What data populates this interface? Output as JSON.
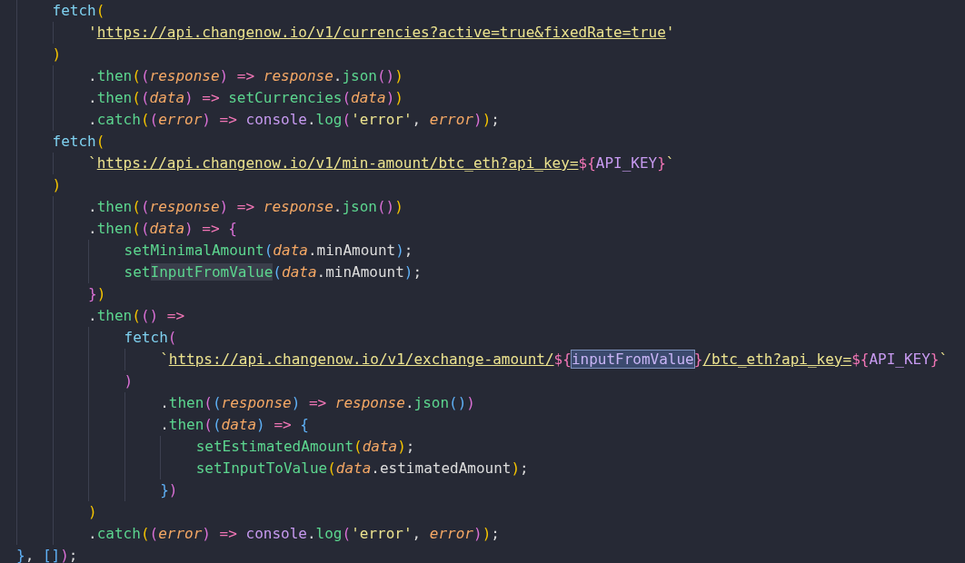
{
  "lines": [
    {
      "tokens": [
        {
          "kind": "call",
          "text": "    fetch"
        },
        {
          "kind": "b1",
          "text": "("
        }
      ]
    },
    {
      "tokens": [
        {
          "kind": "str",
          "text": "        '"
        },
        {
          "kind": "link",
          "text": "https://api.changenow.io/v1/currencies?active=true&fixedRate=true"
        },
        {
          "kind": "str",
          "text": "'"
        }
      ]
    },
    {
      "tokens": [
        {
          "kind": "b1",
          "text": "    )"
        }
      ]
    },
    {
      "tokens": [
        {
          "kind": "plain",
          "text": "        ."
        },
        {
          "kind": "fn",
          "text": "then"
        },
        {
          "kind": "b1",
          "text": "("
        },
        {
          "kind": "b2",
          "text": "("
        },
        {
          "kind": "param",
          "text": "response"
        },
        {
          "kind": "b2",
          "text": ")"
        },
        {
          "kind": "op",
          "text": " => "
        },
        {
          "kind": "param",
          "text": "response"
        },
        {
          "kind": "plain",
          "text": "."
        },
        {
          "kind": "fn",
          "text": "json"
        },
        {
          "kind": "b2",
          "text": "()"
        },
        {
          "kind": "b1",
          "text": ")"
        }
      ]
    },
    {
      "tokens": [
        {
          "kind": "plain",
          "text": "        ."
        },
        {
          "kind": "fn",
          "text": "then"
        },
        {
          "kind": "b1",
          "text": "("
        },
        {
          "kind": "b2",
          "text": "("
        },
        {
          "kind": "param",
          "text": "data"
        },
        {
          "kind": "b2",
          "text": ")"
        },
        {
          "kind": "op",
          "text": " => "
        },
        {
          "kind": "fn",
          "text": "setCurrencies"
        },
        {
          "kind": "b2",
          "text": "("
        },
        {
          "kind": "param",
          "text": "data"
        },
        {
          "kind": "b2",
          "text": ")"
        },
        {
          "kind": "b1",
          "text": ")"
        }
      ]
    },
    {
      "tokens": [
        {
          "kind": "plain",
          "text": "        ."
        },
        {
          "kind": "fn",
          "text": "catch"
        },
        {
          "kind": "b1",
          "text": "("
        },
        {
          "kind": "b2",
          "text": "("
        },
        {
          "kind": "param",
          "text": "error"
        },
        {
          "kind": "b2",
          "text": ")"
        },
        {
          "kind": "op",
          "text": " => "
        },
        {
          "kind": "obj",
          "text": "console"
        },
        {
          "kind": "plain",
          "text": "."
        },
        {
          "kind": "fn",
          "text": "log"
        },
        {
          "kind": "b2",
          "text": "("
        },
        {
          "kind": "str",
          "text": "'error'"
        },
        {
          "kind": "plain",
          "text": ", "
        },
        {
          "kind": "param",
          "text": "error"
        },
        {
          "kind": "b2",
          "text": ")"
        },
        {
          "kind": "b1",
          "text": ")"
        },
        {
          "kind": "plain",
          "text": ";"
        }
      ]
    },
    {
      "tokens": [
        {
          "kind": "call",
          "text": "    fetch"
        },
        {
          "kind": "b1",
          "text": "("
        }
      ]
    },
    {
      "tokens": [
        {
          "kind": "str",
          "text": "        `"
        },
        {
          "kind": "link",
          "text": "https://api.changenow.io/v1/min-amount/btc_eth?api_key="
        },
        {
          "kind": "op",
          "text": "${"
        },
        {
          "kind": "var",
          "text": "API_KEY"
        },
        {
          "kind": "op",
          "text": "}"
        },
        {
          "kind": "str",
          "text": "`"
        }
      ]
    },
    {
      "tokens": [
        {
          "kind": "b1",
          "text": "    )"
        }
      ]
    },
    {
      "tokens": [
        {
          "kind": "plain",
          "text": "        ."
        },
        {
          "kind": "fn",
          "text": "then"
        },
        {
          "kind": "b1",
          "text": "("
        },
        {
          "kind": "b2",
          "text": "("
        },
        {
          "kind": "param",
          "text": "response"
        },
        {
          "kind": "b2",
          "text": ")"
        },
        {
          "kind": "op",
          "text": " => "
        },
        {
          "kind": "param",
          "text": "response"
        },
        {
          "kind": "plain",
          "text": "."
        },
        {
          "kind": "fn",
          "text": "json"
        },
        {
          "kind": "b2",
          "text": "()"
        },
        {
          "kind": "b1",
          "text": ")"
        }
      ]
    },
    {
      "tokens": [
        {
          "kind": "plain",
          "text": "        ."
        },
        {
          "kind": "fn",
          "text": "then"
        },
        {
          "kind": "b1",
          "text": "("
        },
        {
          "kind": "b2",
          "text": "("
        },
        {
          "kind": "param",
          "text": "data"
        },
        {
          "kind": "b2",
          "text": ")"
        },
        {
          "kind": "op",
          "text": " => "
        },
        {
          "kind": "b2",
          "text": "{"
        }
      ]
    },
    {
      "tokens": [
        {
          "kind": "fn",
          "text": "            setMinimalAmount"
        },
        {
          "kind": "b3",
          "text": "("
        },
        {
          "kind": "param",
          "text": "data"
        },
        {
          "kind": "plain",
          "text": ".minAmount"
        },
        {
          "kind": "b3",
          "text": ")"
        },
        {
          "kind": "plain",
          "text": ";"
        }
      ]
    },
    {
      "tokens": [
        {
          "kind": "fn",
          "text": "            set"
        },
        {
          "kind": "fnmatch",
          "text": "InputFromValue"
        },
        {
          "kind": "b3",
          "text": "("
        },
        {
          "kind": "param",
          "text": "data"
        },
        {
          "kind": "plain",
          "text": ".minAmount"
        },
        {
          "kind": "b3",
          "text": ")"
        },
        {
          "kind": "plain",
          "text": ";"
        }
      ]
    },
    {
      "tokens": [
        {
          "kind": "b2",
          "text": "        }"
        },
        {
          "kind": "b1",
          "text": ")"
        }
      ]
    },
    {
      "tokens": [
        {
          "kind": "plain",
          "text": "        ."
        },
        {
          "kind": "fn",
          "text": "then"
        },
        {
          "kind": "b1",
          "text": "("
        },
        {
          "kind": "b2",
          "text": "()"
        },
        {
          "kind": "op",
          "text": " =>"
        }
      ]
    },
    {
      "tokens": [
        {
          "kind": "call",
          "text": "            fetch"
        },
        {
          "kind": "b2",
          "text": "("
        }
      ]
    },
    {
      "tokens": [
        {
          "kind": "str",
          "text": "                `"
        },
        {
          "kind": "link",
          "text": "https://api.changenow.io/v1/exchange-amount/"
        },
        {
          "kind": "op",
          "text": "${"
        },
        {
          "kind": "sel",
          "text": "inputFromValue"
        },
        {
          "kind": "op",
          "text": "}"
        },
        {
          "kind": "link",
          "text": "/btc_eth?api_key="
        },
        {
          "kind": "op",
          "text": "${"
        },
        {
          "kind": "var",
          "text": "API_KEY"
        },
        {
          "kind": "op",
          "text": "}"
        },
        {
          "kind": "str",
          "text": "`"
        }
      ]
    },
    {
      "tokens": [
        {
          "kind": "b2",
          "text": "            )"
        }
      ]
    },
    {
      "tokens": [
        {
          "kind": "plain",
          "text": "                ."
        },
        {
          "kind": "fn",
          "text": "then"
        },
        {
          "kind": "b2",
          "text": "("
        },
        {
          "kind": "b3",
          "text": "("
        },
        {
          "kind": "param",
          "text": "response"
        },
        {
          "kind": "b3",
          "text": ")"
        },
        {
          "kind": "op",
          "text": " => "
        },
        {
          "kind": "param",
          "text": "response"
        },
        {
          "kind": "plain",
          "text": "."
        },
        {
          "kind": "fn",
          "text": "json"
        },
        {
          "kind": "b3",
          "text": "()"
        },
        {
          "kind": "b2",
          "text": ")"
        }
      ]
    },
    {
      "tokens": [
        {
          "kind": "plain",
          "text": "                ."
        },
        {
          "kind": "fn",
          "text": "then"
        },
        {
          "kind": "b2",
          "text": "("
        },
        {
          "kind": "b3",
          "text": "("
        },
        {
          "kind": "param",
          "text": "data"
        },
        {
          "kind": "b3",
          "text": ")"
        },
        {
          "kind": "op",
          "text": " => "
        },
        {
          "kind": "b3",
          "text": "{"
        }
      ]
    },
    {
      "tokens": [
        {
          "kind": "fn",
          "text": "                    setEstimatedAmount"
        },
        {
          "kind": "b1",
          "text": "("
        },
        {
          "kind": "param",
          "text": "data"
        },
        {
          "kind": "b1",
          "text": ")"
        },
        {
          "kind": "plain",
          "text": ";"
        }
      ]
    },
    {
      "tokens": [
        {
          "kind": "fn",
          "text": "                    setInputToValue"
        },
        {
          "kind": "b1",
          "text": "("
        },
        {
          "kind": "param",
          "text": "data"
        },
        {
          "kind": "plain",
          "text": ".estimatedAmount"
        },
        {
          "kind": "b1",
          "text": ")"
        },
        {
          "kind": "plain",
          "text": ";"
        }
      ]
    },
    {
      "tokens": [
        {
          "kind": "b3",
          "text": "                }"
        },
        {
          "kind": "b2",
          "text": ")"
        }
      ]
    },
    {
      "tokens": [
        {
          "kind": "b1",
          "text": "        )"
        }
      ]
    },
    {
      "tokens": [
        {
          "kind": "plain",
          "text": "        ."
        },
        {
          "kind": "fn",
          "text": "catch"
        },
        {
          "kind": "b1",
          "text": "("
        },
        {
          "kind": "b2",
          "text": "("
        },
        {
          "kind": "param",
          "text": "error"
        },
        {
          "kind": "b2",
          "text": ")"
        },
        {
          "kind": "op",
          "text": " => "
        },
        {
          "kind": "obj",
          "text": "console"
        },
        {
          "kind": "plain",
          "text": "."
        },
        {
          "kind": "fn",
          "text": "log"
        },
        {
          "kind": "b2",
          "text": "("
        },
        {
          "kind": "str",
          "text": "'error'"
        },
        {
          "kind": "plain",
          "text": ", "
        },
        {
          "kind": "param",
          "text": "error"
        },
        {
          "kind": "b2",
          "text": ")"
        },
        {
          "kind": "b1",
          "text": ")"
        },
        {
          "kind": "plain",
          "text": ";"
        }
      ]
    },
    {
      "tokens": [
        {
          "kind": "b3",
          "text": "}"
        },
        {
          "kind": "plain",
          "text": ", "
        },
        {
          "kind": "b3",
          "text": "[]"
        },
        {
          "kind": "b2",
          "text": ")"
        },
        {
          "kind": "plain",
          "text": ";"
        }
      ]
    }
  ]
}
